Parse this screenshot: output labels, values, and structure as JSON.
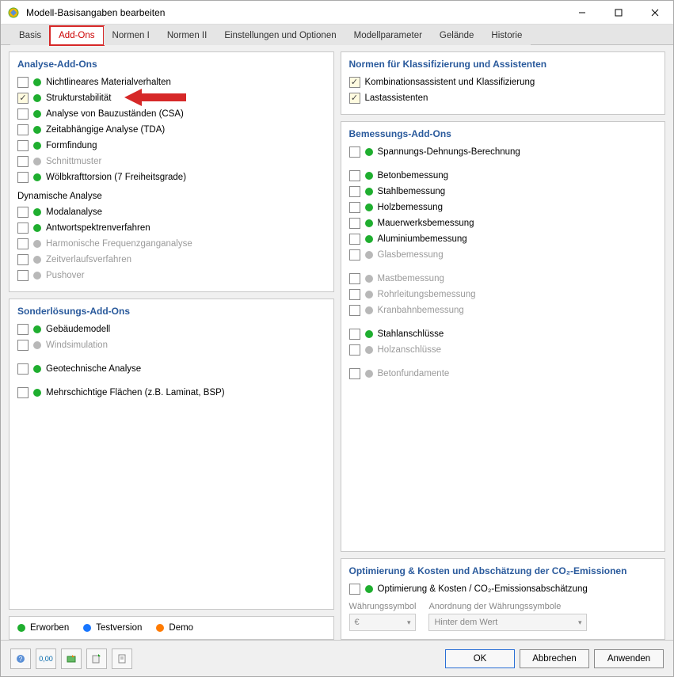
{
  "window": {
    "title": "Modell-Basisangaben bearbeiten"
  },
  "tabs": [
    "Basis",
    "Add-Ons",
    "Normen I",
    "Normen II",
    "Einstellungen und Optionen",
    "Modellparameter",
    "Gelände",
    "Historie"
  ],
  "activeTab": 1,
  "left": {
    "analysis": {
      "title": "Analyse-Add-Ons",
      "items": [
        {
          "label": "Nichtlineares Materialverhalten",
          "checked": false,
          "dot": "green",
          "enabled": true
        },
        {
          "label": "Strukturstabilität",
          "checked": true,
          "dot": "green",
          "enabled": true,
          "highlight": true
        },
        {
          "label": "Analyse von Bauzuständen (CSA)",
          "checked": false,
          "dot": "green",
          "enabled": true
        },
        {
          "label": "Zeitabhängige Analyse (TDA)",
          "checked": false,
          "dot": "green",
          "enabled": true
        },
        {
          "label": "Formfindung",
          "checked": false,
          "dot": "green",
          "enabled": true
        },
        {
          "label": "Schnittmuster",
          "checked": false,
          "dot": "gray",
          "enabled": false
        },
        {
          "label": "Wölbkrafttorsion (7 Freiheitsgrade)",
          "checked": false,
          "dot": "green",
          "enabled": true
        }
      ],
      "dyn_title": "Dynamische Analyse",
      "dyn_items": [
        {
          "label": "Modalanalyse",
          "checked": false,
          "dot": "green",
          "enabled": true
        },
        {
          "label": "Antwortspektrenverfahren",
          "checked": false,
          "dot": "green",
          "enabled": true
        },
        {
          "label": "Harmonische Frequenzganganalyse",
          "checked": false,
          "dot": "gray",
          "enabled": false
        },
        {
          "label": "Zeitverlaufsverfahren",
          "checked": false,
          "dot": "gray",
          "enabled": false
        },
        {
          "label": "Pushover",
          "checked": false,
          "dot": "gray",
          "enabled": false
        }
      ]
    },
    "special": {
      "title": "Sonderlösungs-Add-Ons",
      "items": [
        {
          "label": "Gebäudemodell",
          "checked": false,
          "dot": "green",
          "enabled": true
        },
        {
          "label": "Windsimulation",
          "checked": false,
          "dot": "gray",
          "enabled": false
        },
        {
          "label": "",
          "checked": null,
          "dot": null,
          "enabled": false
        },
        {
          "label": "Geotechnische Analyse",
          "checked": false,
          "dot": "green",
          "enabled": true
        },
        {
          "label": "",
          "checked": null,
          "dot": null,
          "enabled": false
        },
        {
          "label": "Mehrschichtige Flächen (z.B. Laminat, BSP)",
          "checked": false,
          "dot": "green",
          "enabled": true
        }
      ]
    }
  },
  "right": {
    "norms": {
      "title": "Normen für Klassifizierung und Assistenten",
      "items": [
        {
          "label": "Kombinationsassistent und Klassifizierung",
          "checked": true,
          "dot": null,
          "enabled": true
        },
        {
          "label": "Lastassistenten",
          "checked": true,
          "dot": null,
          "enabled": true
        }
      ]
    },
    "design": {
      "title": "Bemessungs-Add-Ons",
      "items": [
        {
          "label": "Spannungs-Dehnungs-Berechnung",
          "checked": false,
          "dot": "green",
          "enabled": true
        },
        {
          "label": "",
          "checked": null,
          "dot": null,
          "enabled": false
        },
        {
          "label": "Betonbemessung",
          "checked": false,
          "dot": "green",
          "enabled": true
        },
        {
          "label": "Stahlbemessung",
          "checked": false,
          "dot": "green",
          "enabled": true
        },
        {
          "label": "Holzbemessung",
          "checked": false,
          "dot": "green",
          "enabled": true
        },
        {
          "label": "Mauerwerksbemessung",
          "checked": false,
          "dot": "green",
          "enabled": true
        },
        {
          "label": "Aluminiumbemessung",
          "checked": false,
          "dot": "green",
          "enabled": true
        },
        {
          "label": "Glasbemessung",
          "checked": false,
          "dot": "gray",
          "enabled": false
        },
        {
          "label": "",
          "checked": null,
          "dot": null,
          "enabled": false
        },
        {
          "label": "Mastbemessung",
          "checked": false,
          "dot": "gray",
          "enabled": false
        },
        {
          "label": "Rohrleitungsbemessung",
          "checked": false,
          "dot": "gray",
          "enabled": false
        },
        {
          "label": "Kranbahnbemessung",
          "checked": false,
          "dot": "gray",
          "enabled": false
        },
        {
          "label": "",
          "checked": null,
          "dot": null,
          "enabled": false
        },
        {
          "label": "Stahlanschlüsse",
          "checked": false,
          "dot": "green",
          "enabled": true
        },
        {
          "label": "Holzanschlüsse",
          "checked": false,
          "dot": "gray",
          "enabled": false
        },
        {
          "label": "",
          "checked": null,
          "dot": null,
          "enabled": false
        },
        {
          "label": "Betonfundamente",
          "checked": false,
          "dot": "gray",
          "enabled": false
        }
      ]
    },
    "opt": {
      "title": "Optimierung & Kosten und Abschätzung der CO₂-Emissionen",
      "item": {
        "label": "Optimierung & Kosten / CO₂-Emissionsabschätzung",
        "checked": false,
        "dot": "green",
        "enabled": true
      },
      "currency_lbl": "Währungssymbol",
      "currency_val": "€",
      "arrangement_lbl": "Anordnung der Währungssymbole",
      "arrangement_val": "Hinter dem Wert"
    }
  },
  "legend": {
    "acquired": "Erworben",
    "test": "Testversion",
    "demo": "Demo"
  },
  "buttons": {
    "ok": "OK",
    "cancel": "Abbrechen",
    "apply": "Anwenden"
  }
}
